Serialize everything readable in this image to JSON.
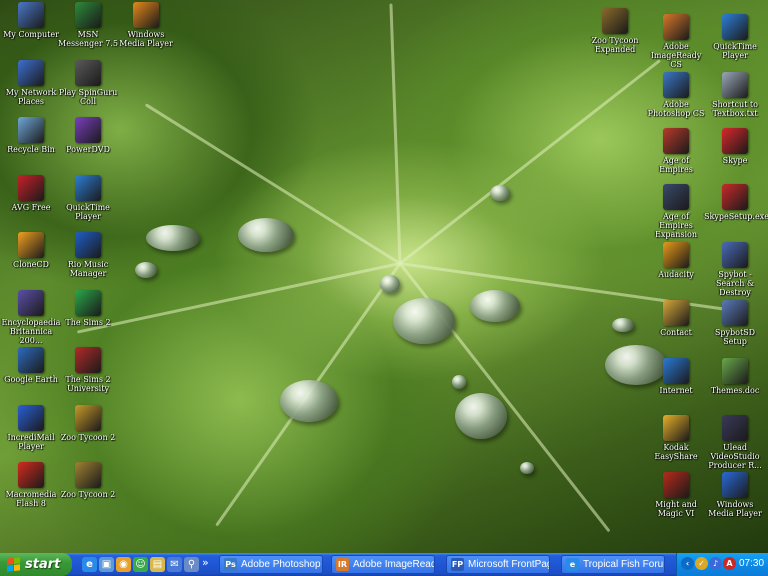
{
  "desktop_icons": [
    {
      "label": "My Computer",
      "icon": "my-computer-icon",
      "color": "#4a78c8"
    },
    {
      "label": "MSN Messenger 7.5",
      "icon": "msn-messenger-icon",
      "color": "#2e8b3a"
    },
    {
      "label": "Windows Media Player",
      "icon": "media-player-icon",
      "color": "#e58a1b"
    },
    {
      "label": "My Network Places",
      "icon": "network-places-icon",
      "color": "#3d6fd0"
    },
    {
      "label": "Play SpinGuru Coll",
      "icon": "spin-game-icon",
      "color": "#5a5a5a"
    },
    {
      "label": "Recycle Bin",
      "icon": "recycle-bin-icon",
      "color": "#6fa7d8"
    },
    {
      "label": "PowerDVD",
      "icon": "powerdvd-icon",
      "color": "#7a3fbf"
    },
    {
      "label": "AVG Free",
      "icon": "avg-icon",
      "color": "#c8202a"
    },
    {
      "label": "QuickTime Player",
      "icon": "quicktime-icon",
      "color": "#2d7fd6"
    },
    {
      "label": "CloneCD",
      "icon": "clonecd-icon",
      "color": "#f0a020"
    },
    {
      "label": "Rio Music Manager",
      "icon": "rio-music-icon",
      "color": "#1f5fc8"
    },
    {
      "label": "Encyclopaedia Britannica 200...",
      "icon": "britannica-icon",
      "color": "#5b4fa8"
    },
    {
      "label": "The Sims 2",
      "icon": "sims-icon",
      "color": "#2aa84a"
    },
    {
      "label": "Google Earth",
      "icon": "google-earth-icon",
      "color": "#2d6cc0"
    },
    {
      "label": "The Sims 2 University",
      "icon": "sims-university-icon",
      "color": "#b52a2a"
    },
    {
      "label": "IncrediMail Player",
      "icon": "incredimail-icon",
      "color": "#2a5fd8"
    },
    {
      "label": "Zoo Tycoon 2",
      "icon": "zoo-tycoon-2-icon",
      "color": "#c79a2a"
    },
    {
      "label": "Macromedia Flash 8",
      "icon": "flash-icon",
      "color": "#d42a1f"
    },
    {
      "label": "Zoo Tycoon 2",
      "icon": "zoo-tycoon-2b-icon",
      "color": "#a08232"
    },
    {
      "label": "Zoo Tycoon Expanded",
      "icon": "zoo-tycoon-icon",
      "color": "#8a6a2a"
    },
    {
      "label": "Adobe ImageReady CS",
      "icon": "imageready-icon",
      "color": "#d8782a"
    },
    {
      "label": "QuickTime Player",
      "icon": "quicktime-icon",
      "color": "#2d7fd6"
    },
    {
      "label": "Adobe Photoshop CS",
      "icon": "photoshop-icon",
      "color": "#3a78c8"
    },
    {
      "label": "Shortcut to Textbox.txt",
      "icon": "textfile-icon",
      "color": "#9aa8b8"
    },
    {
      "label": "Age of Empires",
      "icon": "age-of-empires-icon",
      "color": "#b83a2a"
    },
    {
      "label": "Skype",
      "icon": "skype-icon",
      "color": "#d8282a"
    },
    {
      "label": "Age of Empires Expansion",
      "icon": "aoe-expansion-icon",
      "color": "#3a4a6a"
    },
    {
      "label": "SkypeSetup.exe",
      "icon": "skype-setup-icon",
      "color": "#c82a2a"
    },
    {
      "label": "Audacity",
      "icon": "audacity-icon",
      "color": "#e89a1a"
    },
    {
      "label": "Spybot - Search & Destroy",
      "icon": "spybot-icon",
      "color": "#4a6ab8"
    },
    {
      "label": "Contact",
      "icon": "contact-icon",
      "color": "#d8a83a"
    },
    {
      "label": "SpybotSD Setup",
      "icon": "spybot-setup-icon",
      "color": "#5a7ab8"
    },
    {
      "label": "Internet",
      "icon": "internet-explorer-icon",
      "color": "#2a7ad8"
    },
    {
      "label": "Themes.doc",
      "icon": "document-icon",
      "color": "#6aa84a"
    },
    {
      "label": "Kodak EasyShare",
      "icon": "kodak-icon",
      "color": "#e8b02a"
    },
    {
      "label": "Ulead VideoStudio Producer R...",
      "icon": "ulead-icon",
      "color": "#3a3a5a"
    },
    {
      "label": "Might and Magic VI",
      "icon": "might-magic-icon",
      "color": "#b82a1a"
    },
    {
      "label": "Windows Media Player",
      "icon": "media-player-icon",
      "color": "#2a6ad8"
    }
  ],
  "taskbar": {
    "start_label": "start",
    "quick_launch": [
      {
        "icon": "ie-quicklaunch-icon",
        "glyph": "e",
        "color": "#2a8ae8"
      },
      {
        "icon": "desktop-quicklaunch-icon",
        "glyph": "▣",
        "color": "#5a9ad8"
      },
      {
        "icon": "media-quicklaunch-icon",
        "glyph": "◉",
        "color": "#e8a02a"
      },
      {
        "icon": "msn-quicklaunch-icon",
        "glyph": "☺",
        "color": "#3aa84a"
      },
      {
        "icon": "folder-quicklaunch-icon",
        "glyph": "▤",
        "color": "#d8b84a"
      },
      {
        "icon": "mail-quicklaunch-icon",
        "glyph": "✉",
        "color": "#4a7ad8"
      },
      {
        "icon": "search-quicklaunch-icon",
        "glyph": "⚲",
        "color": "#6a8ac8"
      }
    ],
    "overflow_label": "»",
    "tasks": [
      {
        "label": "Adobe Photoshop - ...",
        "icon": "photoshop-task-icon",
        "glyph": "Ps",
        "color": "#3a78c8"
      },
      {
        "label": "Adobe ImageReady ...",
        "icon": "imageready-task-icon",
        "glyph": "IR",
        "color": "#d8782a"
      },
      {
        "label": "Microsoft FrontPage...",
        "icon": "frontpage-task-icon",
        "glyph": "FP",
        "color": "#2a5ab8"
      },
      {
        "label": "Tropical Fish Forums...",
        "icon": "ie-task-icon",
        "glyph": "e",
        "color": "#2a8ae8"
      }
    ],
    "tray_icons": [
      {
        "icon": "tray-arrow-icon",
        "glyph": "‹",
        "color": "#0b6bc6"
      },
      {
        "icon": "tray-shield-icon",
        "glyph": "✓",
        "color": "#d8a82a"
      },
      {
        "icon": "tray-speaker-icon",
        "glyph": "♪",
        "color": "#3a6ad8"
      },
      {
        "icon": "tray-antivirus-icon",
        "glyph": "A",
        "color": "#c82a2a"
      }
    ],
    "clock": "07:30"
  }
}
